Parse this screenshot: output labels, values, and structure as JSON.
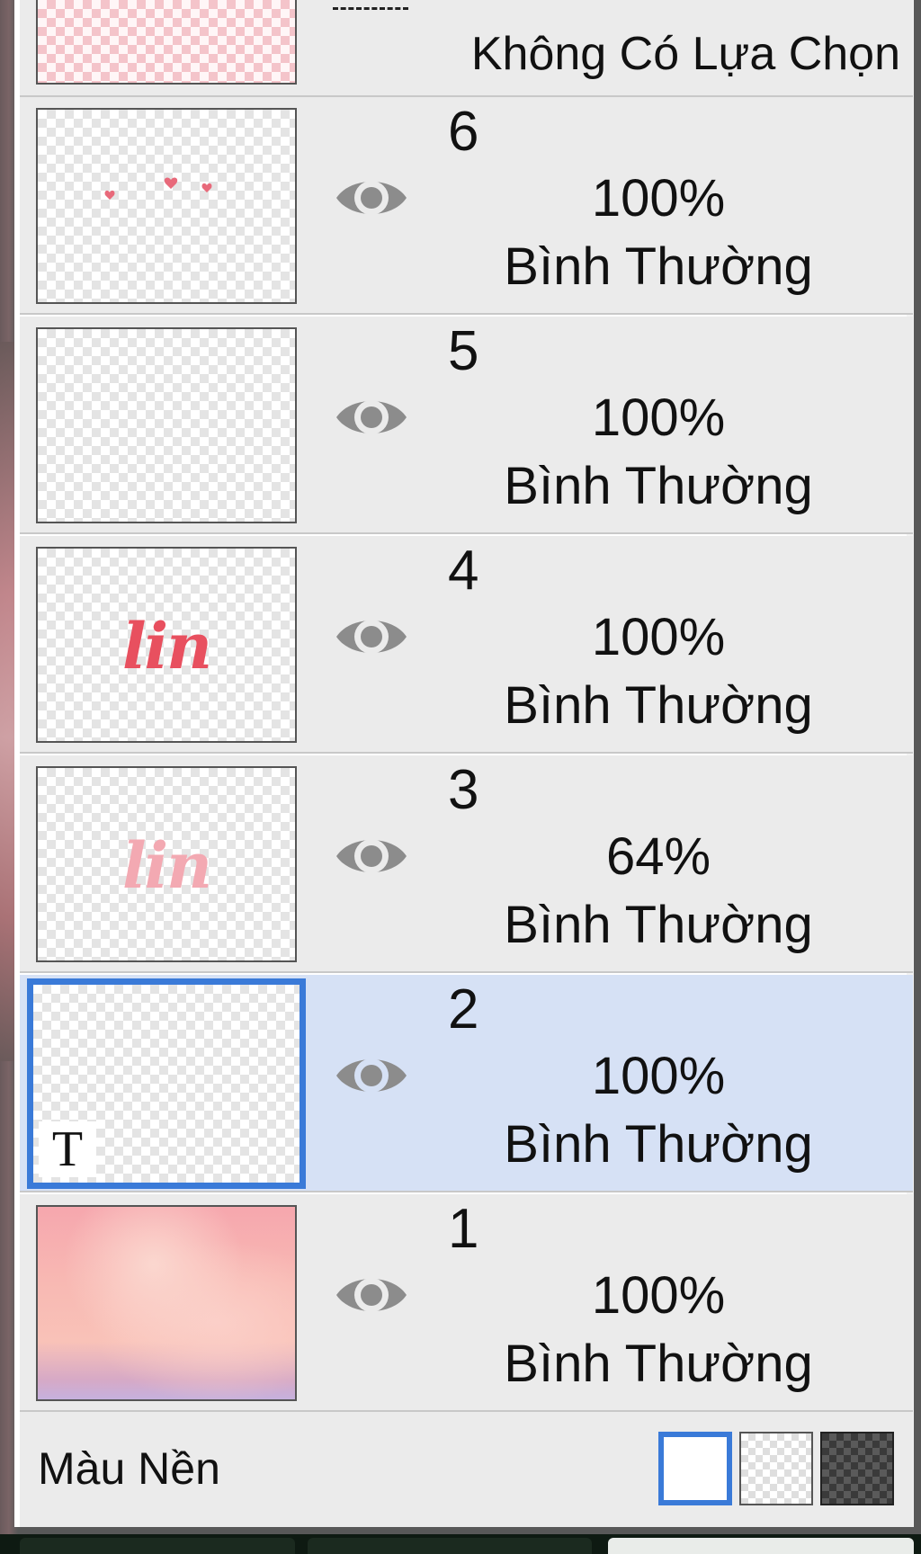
{
  "top_layer": {
    "label": "Không Có Lựa Chọn"
  },
  "layers": [
    {
      "name": "6",
      "opacity": "100%",
      "blend": "Bình Thường",
      "thumb": "hearts",
      "selected": false
    },
    {
      "name": "5",
      "opacity": "100%",
      "blend": "Bình Thường",
      "thumb": "blank",
      "selected": false
    },
    {
      "name": "4",
      "opacity": "100%",
      "blend": "Bình Thường",
      "thumb": "lin-text",
      "selected": false
    },
    {
      "name": "3",
      "opacity": "64%",
      "blend": "Bình Thường",
      "thumb": "lin-text-faded",
      "selected": false
    },
    {
      "name": "2",
      "opacity": "100%",
      "blend": "Bình Thường",
      "thumb": "text-layer",
      "selected": true
    },
    {
      "name": "1",
      "opacity": "100%",
      "blend": "Bình Thường",
      "thumb": "sky",
      "selected": false
    }
  ],
  "thumb_text": {
    "lin": "lin",
    "t_glyph": "T"
  },
  "footer": {
    "label": "Màu Nền",
    "swatches": [
      "white",
      "transparent-checker",
      "dark-checker"
    ],
    "selected_swatch": "white"
  },
  "icons": {
    "visibility": "eye-icon",
    "text_layer": "text-layer-icon"
  },
  "colors": {
    "selected_row": "#d6e1f5",
    "selection_border": "#3a7ad8",
    "row_bg": "#ebebeb",
    "lin_text": "#e8505f",
    "lin_text_faded": "#f3a9b2",
    "heart": "#e8697a"
  }
}
